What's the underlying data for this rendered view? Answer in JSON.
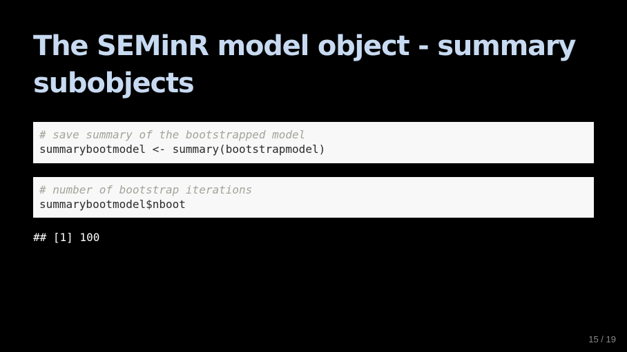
{
  "slide": {
    "title": "The SEMinR model object - summary subobjects",
    "page_number": "15 / 19"
  },
  "code_blocks": [
    {
      "comment": "# save summary of the bootstrapped model",
      "code": "summarybootmodel <- summary(bootstrapmodel)"
    },
    {
      "comment": "# number of bootstrap iterations",
      "code": "summarybootmodel$nboot"
    }
  ],
  "output": {
    "line": "## [1] 100"
  },
  "colors": {
    "background": "#000000",
    "title": "#c7daf1",
    "code_background": "#f8f8f8",
    "comment": "#a3a39b",
    "code_text": "#2a2a2a",
    "output_text": "#ffffff"
  }
}
